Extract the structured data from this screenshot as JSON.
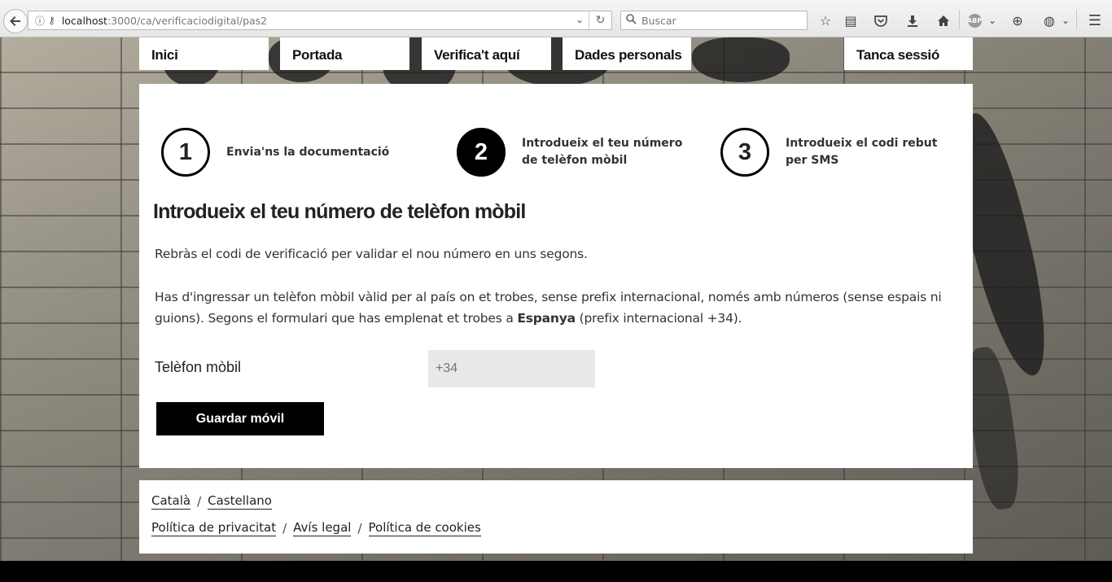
{
  "browser": {
    "url_host": "localhost",
    "url_path": ":3000/ca/verificaciodigital/pas2",
    "search_placeholder": "Buscar"
  },
  "nav": {
    "inici": "Inici",
    "portada": "Portada",
    "verifica": "Verifica't aquí",
    "dades": "Dades personals",
    "tanca": "Tanca sessió"
  },
  "steps": [
    {
      "number": "1",
      "label_line1": "Envia'ns la documentació",
      "label_line2": "",
      "active": false
    },
    {
      "number": "2",
      "label_line1": "Introdueix el teu número",
      "label_line2": "de telèfon mòbil",
      "active": true
    },
    {
      "number": "3",
      "label_line1": "Introdueix el codi rebut",
      "label_line2": "per SMS",
      "active": false
    }
  ],
  "main": {
    "title": "Introdueix el teu número de telèfon mòbil",
    "intro": "Rebràs el codi de verificació per validar el nou número en uns segons.",
    "info_part1": "Has d'ingressar un telèfon mòbil vàlid per al país on et trobes, sense prefix internacional, només amb números (sense espais ni guions). Segons el formulari que has emplenat et trobes a ",
    "info_country": "Espanya",
    "info_part2": " (prefix internacional +34).",
    "phone_label": "Telèfon mòbil",
    "phone_placeholder": "+34",
    "save_button": "Guardar móvil"
  },
  "footer": {
    "lang_catala": "Català",
    "lang_castellano": "Castellano",
    "privacy": "Política de privacitat",
    "legal": "Avís legal",
    "cookies": "Política de cookies",
    "separator": "/"
  }
}
